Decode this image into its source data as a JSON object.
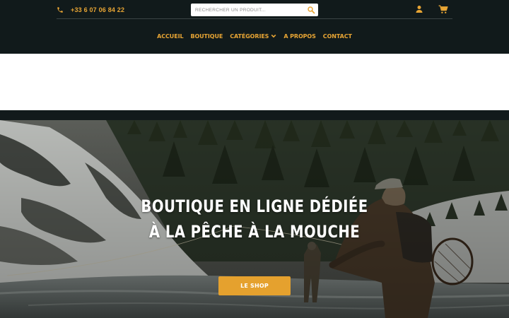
{
  "header": {
    "phone": {
      "icon": "phone-icon",
      "number": "+33 6 07 06 84 22"
    },
    "search": {
      "placeholder": "RECHERCHER UN PRODUIT...",
      "icon": "search-icon"
    },
    "user_icon": "user-icon",
    "cart_icon": "cart-icon"
  },
  "nav": {
    "items": [
      {
        "label": "ACCUEIL"
      },
      {
        "label": "BOUTIQUE"
      },
      {
        "label": "CATÉGORIES",
        "icon": "chevron-down-icon"
      },
      {
        "label": "A PROPOS"
      },
      {
        "label": "CONTACT"
      }
    ]
  },
  "hero": {
    "title_line1": "BOUTIQUE EN LIGNE DÉDIÉE",
    "title_line2": "À LA PÊCHE À LA MOUCHE",
    "cta_label": "LE SHOP"
  },
  "colors": {
    "accent": "#e8a534",
    "header_bg": "#111a1b",
    "button_bg": "#e5a12e"
  }
}
